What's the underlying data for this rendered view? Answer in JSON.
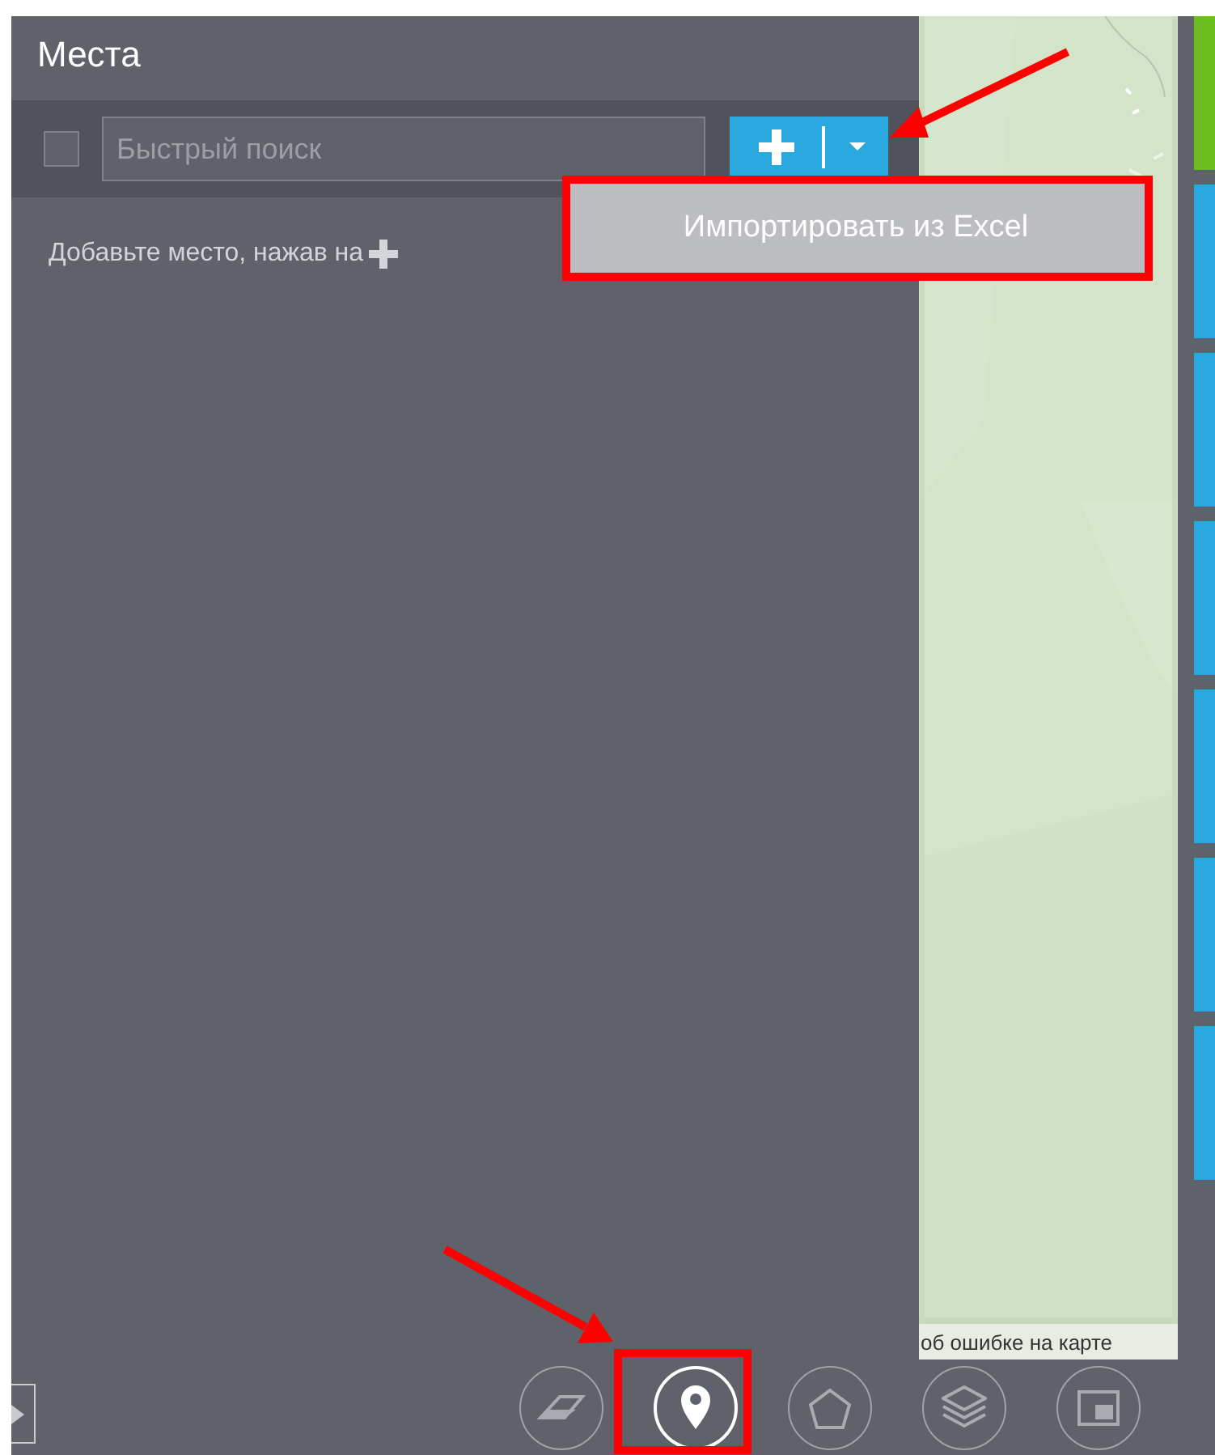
{
  "panel": {
    "title": "Места",
    "select_all": {
      "checked": false
    },
    "search": {
      "placeholder": "Быстрый поиск"
    },
    "add_menu": {
      "open": true,
      "items": [
        "Импортировать из Excel"
      ]
    },
    "hint": "Добавьте место, нажав на"
  },
  "map": {
    "kind": "picture",
    "attribution": "об ошибке на карте"
  },
  "side_tabs": [
    {
      "color": "#6cbd1f"
    },
    {
      "color": "#29a8e0"
    },
    {
      "color": "#29a8e0"
    },
    {
      "color": "#29a8e0"
    },
    {
      "color": "#29a8e0"
    },
    {
      "color": "#29a8e0"
    },
    {
      "color": "#29a8e0"
    }
  ],
  "tools": [
    {
      "kind": "eraser",
      "selected": false
    },
    {
      "kind": "pin",
      "selected": true
    },
    {
      "kind": "polygon",
      "selected": false
    },
    {
      "kind": "layers",
      "selected": false
    },
    {
      "kind": "minimap",
      "selected": false
    }
  ]
}
